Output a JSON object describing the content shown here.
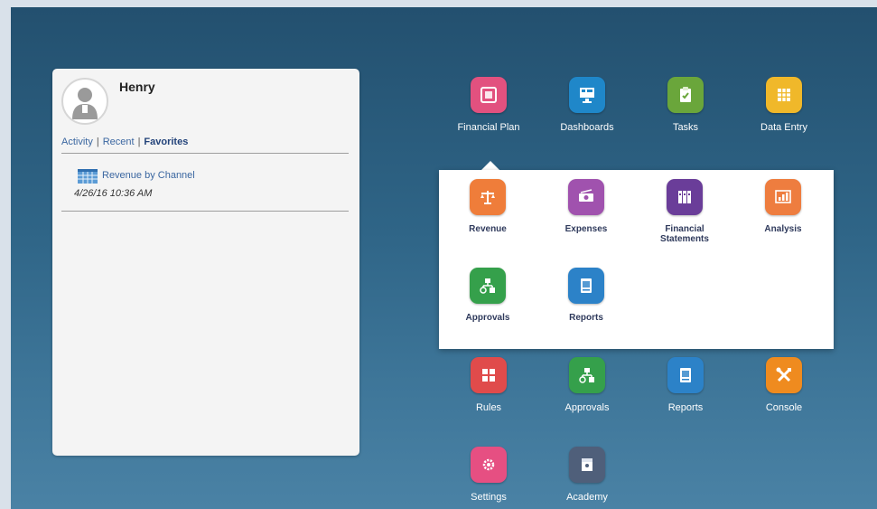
{
  "user_panel": {
    "name": "Henry",
    "tabs": {
      "activity": "Activity",
      "recent": "Recent",
      "favorites": "Favorites",
      "separator": "|"
    },
    "favorite": {
      "title": "Revenue by Channel",
      "date": "4/26/16 10:36 AM"
    }
  },
  "apps": {
    "financial_plan": "Financial Plan",
    "dashboards": "Dashboards",
    "tasks": "Tasks",
    "data_entry": "Data Entry",
    "rules": "Rules",
    "approvals": "Approvals",
    "reports": "Reports",
    "console": "Console",
    "settings": "Settings",
    "academy": "Academy"
  },
  "submenu": {
    "revenue": "Revenue",
    "expenses": "Expenses",
    "financial_statements": "Financial Statements",
    "analysis": "Analysis",
    "approvals": "Approvals",
    "reports": "Reports"
  },
  "icons": {
    "financial_plan": "financial-plan-icon",
    "dashboards": "dashboard-monitor-icon",
    "tasks": "clipboard-check-icon",
    "data_entry": "grid-icon",
    "revenue": "scales-icon",
    "expenses": "money-icon",
    "financial_statements": "binders-icon",
    "analysis": "chart-icon",
    "approvals": "hierarchy-icon",
    "reports": "report-icon",
    "rules": "rules-grid-icon",
    "console": "tools-icon",
    "settings": "gear-icon",
    "academy": "academy-icon"
  },
  "colors": {
    "financial_plan": "#e2517f",
    "dashboards": "#1f87c9",
    "tasks": "#6aa63b",
    "data_entry": "#f0b82a",
    "revenue": "#ef7d3a",
    "expenses": "#a052ae",
    "financial_statements": "#6a3d99",
    "analysis": "#ee7d3f",
    "approvals": "#35a04b",
    "reports": "#2c82c8",
    "rules": "#e04b4b",
    "console": "#ef8b1f",
    "settings": "#e64f82",
    "academy": "#4f5f7a"
  }
}
